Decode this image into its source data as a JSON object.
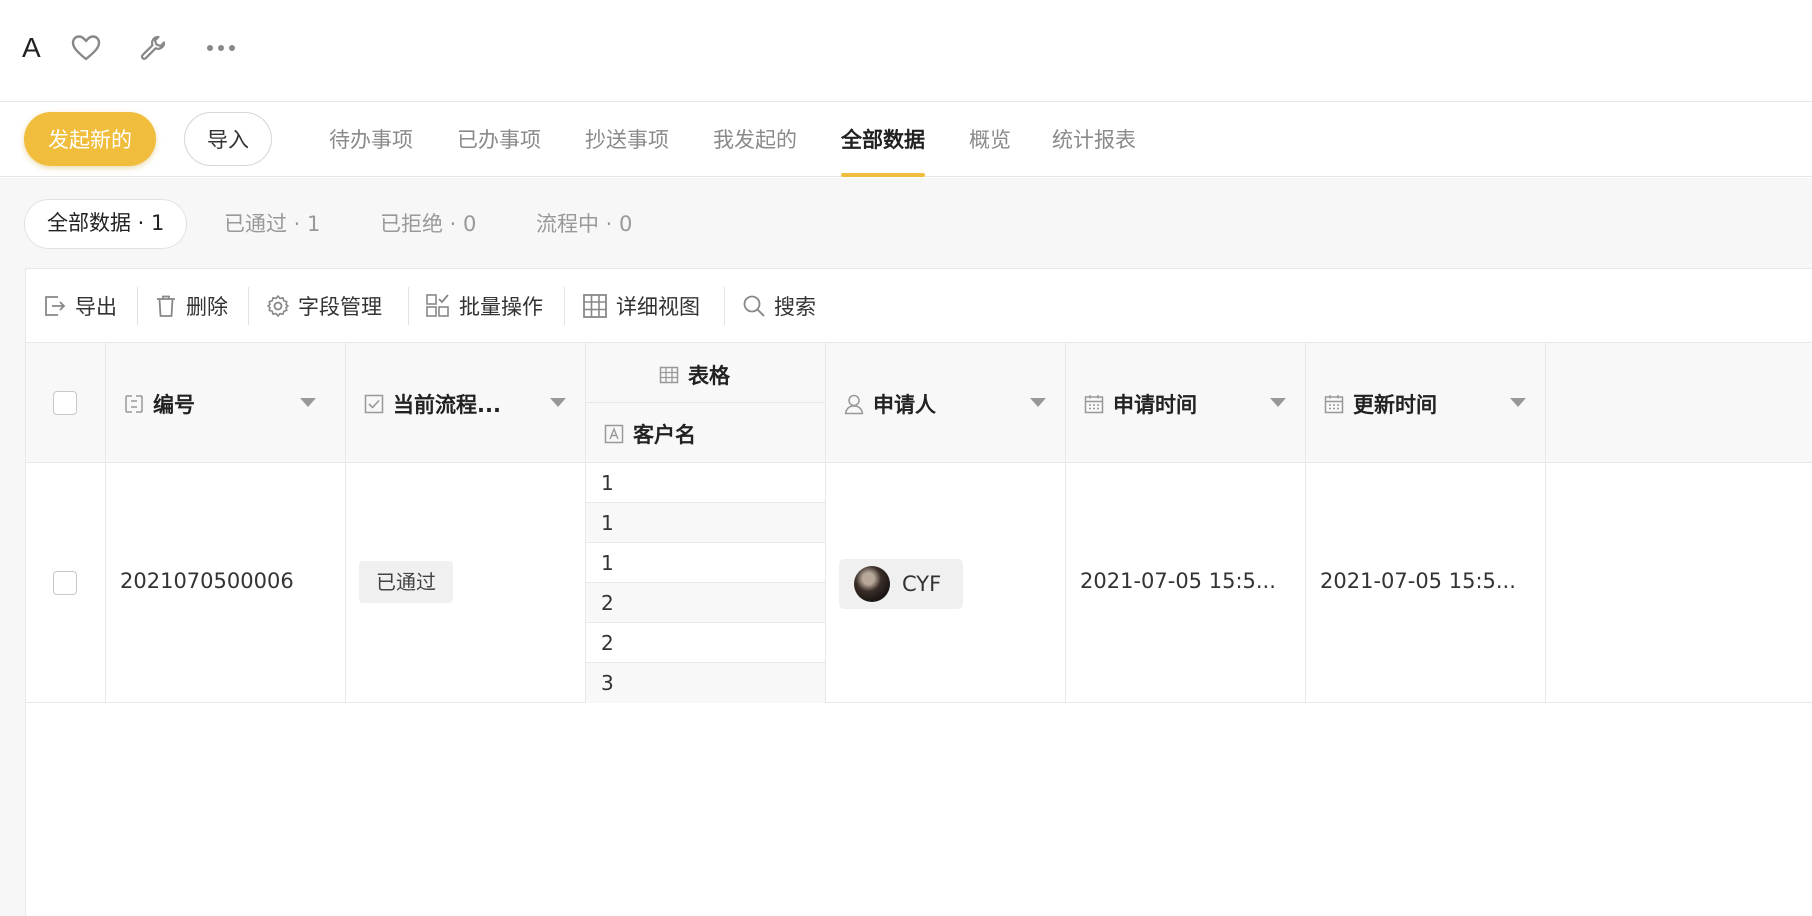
{
  "header": {
    "title": "A",
    "icons": [
      "heart-icon",
      "wrench-icon",
      "more-icon"
    ]
  },
  "nav": {
    "primary_button": "发起新的",
    "import_button": "导入",
    "tabs": [
      {
        "label": "待办事项",
        "active": false
      },
      {
        "label": "已办事项",
        "active": false
      },
      {
        "label": "抄送事项",
        "active": false
      },
      {
        "label": "我发起的",
        "active": false
      },
      {
        "label": "全部数据",
        "active": true
      },
      {
        "label": "概览",
        "active": false
      },
      {
        "label": "统计报表",
        "active": false
      }
    ],
    "accent_color": "#f0be3c"
  },
  "filters": [
    {
      "label": "全部数据 · 1",
      "active": true
    },
    {
      "label": "已通过 · 1",
      "active": false
    },
    {
      "label": "已拒绝 · 0",
      "active": false
    },
    {
      "label": "流程中 · 0",
      "active": false
    }
  ],
  "toolbar": {
    "export": "导出",
    "delete": "删除",
    "fields": "字段管理",
    "batch": "批量操作",
    "detail_view": "详细视图",
    "search": "搜索"
  },
  "table": {
    "columns": {
      "number": "编号",
      "flow": "当前流程...",
      "group": "表格",
      "customer": "客户名",
      "applicant": "申请人",
      "apply_time": "申请时间",
      "update_time": "更新时间"
    },
    "rows": [
      {
        "number": "2021070500006",
        "flow_status": "已通过",
        "customers": [
          "1",
          "1",
          "1",
          "2",
          "2",
          "3"
        ],
        "applicant": "CYF",
        "apply_time": "2021-07-05 15:5...",
        "update_time": "2021-07-05 15:5..."
      }
    ]
  }
}
